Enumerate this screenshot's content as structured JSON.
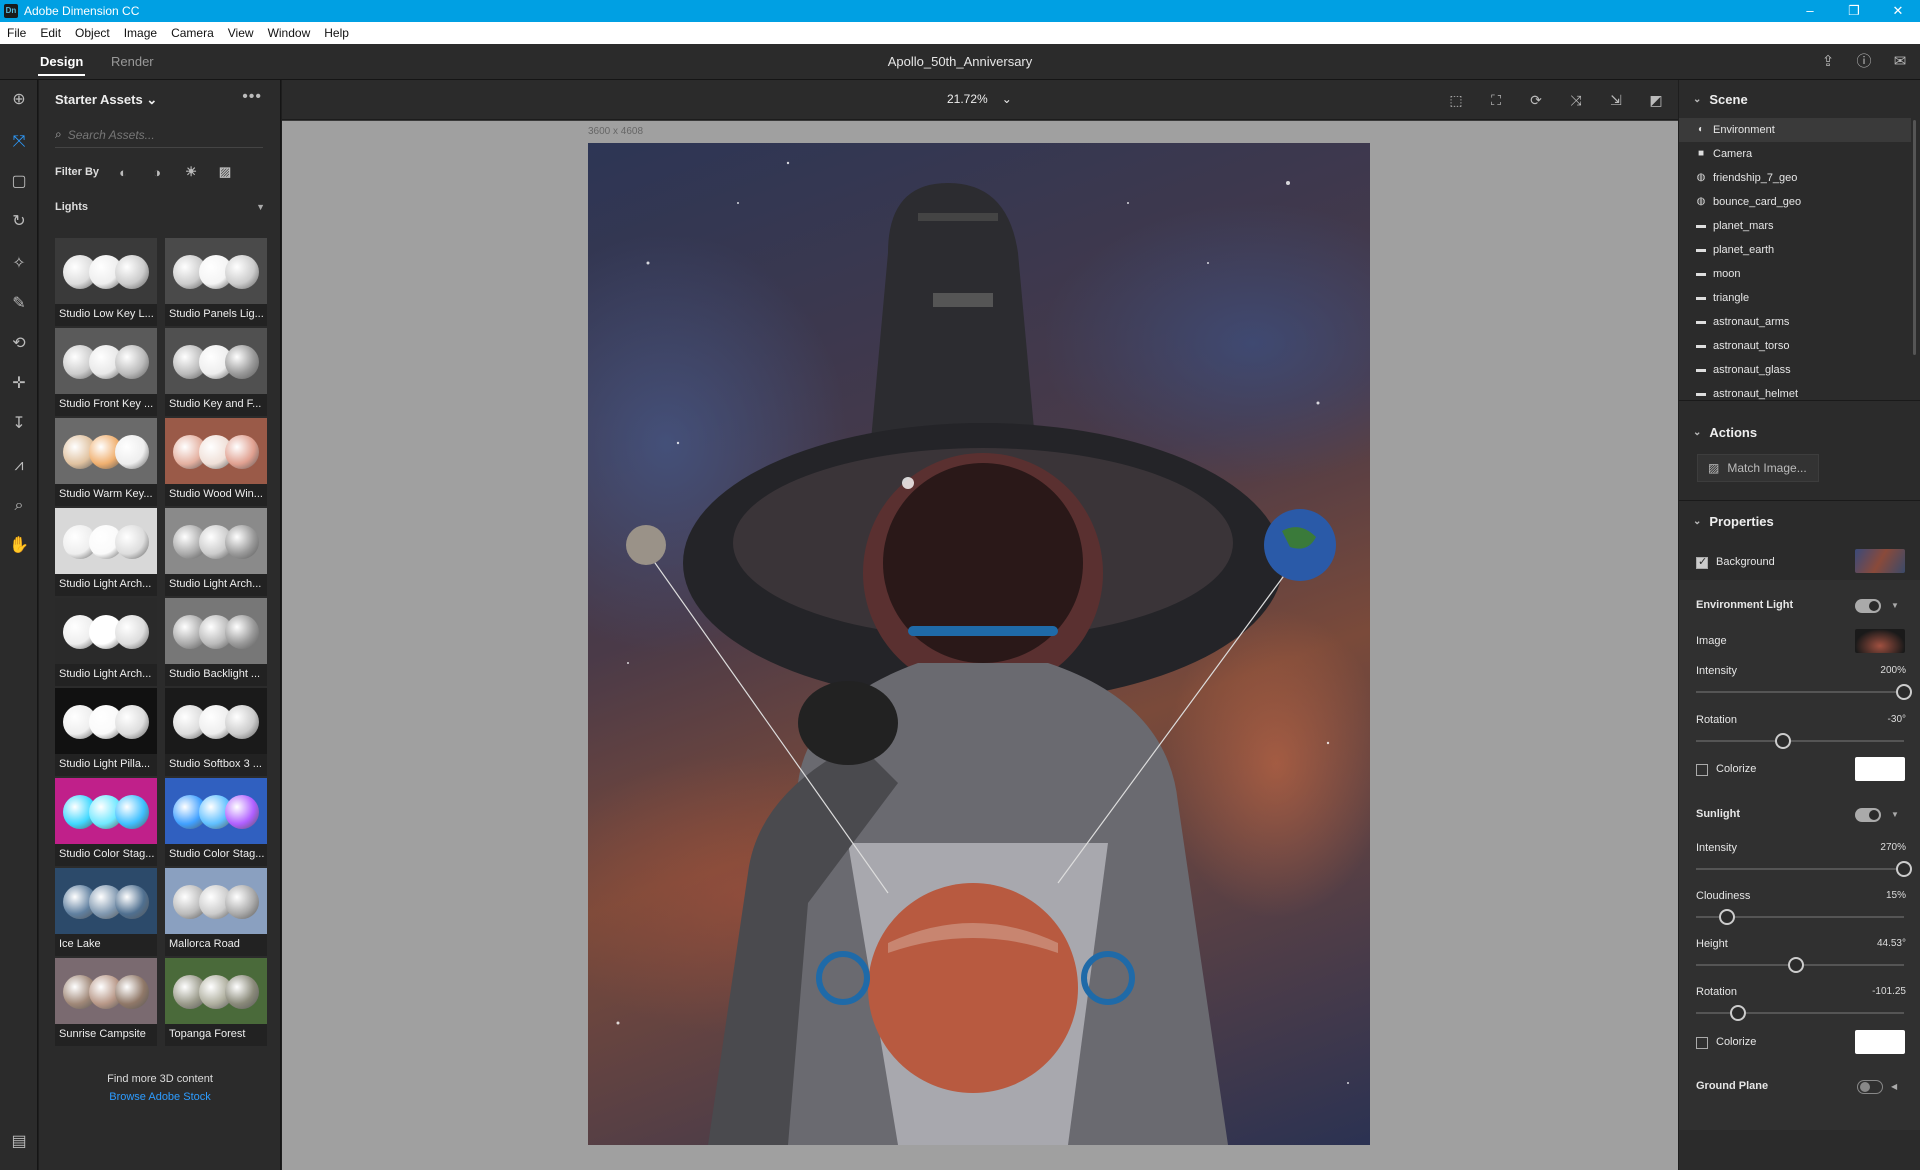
{
  "window": {
    "app_title": "Adobe Dimension CC",
    "app_icon": "Dn",
    "minimize": "–",
    "restore": "❐",
    "close": "✕"
  },
  "menu": [
    "File",
    "Edit",
    "Object",
    "Image",
    "Camera",
    "View",
    "Window",
    "Help"
  ],
  "modes": {
    "design": "Design",
    "render": "Render"
  },
  "document": {
    "title": "Apollo_50th_Anniversary",
    "dimensions": "3600 x 4608",
    "zoom": "21.72%"
  },
  "assets": {
    "header": "Starter Assets",
    "search_placeholder": "Search Assets...",
    "filter_label": "Filter By",
    "category": "Lights",
    "items": [
      {
        "label": "Studio Low Key L...",
        "colors": [
          "#ddd",
          "#eee",
          "#ccc"
        ],
        "bg": "#3a3a3a"
      },
      {
        "label": "Studio Panels Lig...",
        "colors": [
          "#ccc",
          "#f4f4f4",
          "#ccc"
        ],
        "bg": "#4a4a4a"
      },
      {
        "label": "Studio Front Key ...",
        "colors": [
          "#ccc",
          "#e8e8e8",
          "#bbb"
        ],
        "bg": "#5a5a5a"
      },
      {
        "label": "Studio Key and F...",
        "colors": [
          "#bbb",
          "#eee",
          "#999"
        ],
        "bg": "#505050"
      },
      {
        "label": "Studio Warm Key...",
        "colors": [
          "#e0c2a0",
          "#f0b070",
          "#eee"
        ],
        "bg": "#6a6a6a"
      },
      {
        "label": "Studio Wood Win...",
        "colors": [
          "#e4b0a0",
          "#f0e0d8",
          "#e0a090"
        ],
        "bg": "#9a5a48"
      },
      {
        "label": "Studio Light Arch...",
        "colors": [
          "#eee",
          "#fafafa",
          "#ddd"
        ],
        "bg": "#d8d8d8"
      },
      {
        "label": "Studio Light Arch...",
        "colors": [
          "#aaa",
          "#ccc",
          "#999"
        ],
        "bg": "#8a8a8a"
      },
      {
        "label": "Studio Light Arch...",
        "colors": [
          "#eee",
          "#fff",
          "#ddd"
        ],
        "bg": "#2a2a2a"
      },
      {
        "label": "Studio Backlight ...",
        "colors": [
          "#aaa",
          "#bbb",
          "#999"
        ],
        "bg": "#777"
      },
      {
        "label": "Studio Light Pilla...",
        "colors": [
          "#eee",
          "#fafafa",
          "#ddd"
        ],
        "bg": "#111"
      },
      {
        "label": "Studio Softbox 3 ...",
        "colors": [
          "#ddd",
          "#eee",
          "#ccc"
        ],
        "bg": "#1a1a1a"
      },
      {
        "label": "Studio Color Stag...",
        "colors": [
          "#40d8ff",
          "#70e8ff",
          "#40c0ff"
        ],
        "bg": "#c0208a"
      },
      {
        "label": "Studio Color Stag...",
        "colors": [
          "#40a0ff",
          "#60c0ff",
          "#b060ff"
        ],
        "bg": "#3060c0"
      },
      {
        "label": "Ice Lake",
        "colors": [
          "#6080a0",
          "#8098b0",
          "#507090"
        ],
        "bg": "#2c4a6a"
      },
      {
        "label": "Mallorca Road",
        "colors": [
          "#bbb",
          "#ccc",
          "#aaa"
        ],
        "bg": "#8aa0c0"
      },
      {
        "label": "Sunrise Campsite",
        "colors": [
          "#a08878",
          "#b89888",
          "#907868"
        ],
        "bg": "#7a6a70"
      },
      {
        "label": "Topanga Forest",
        "colors": [
          "#9a9a8a",
          "#b0b0a0",
          "#8a8a7a"
        ],
        "bg": "#4a6a3a"
      }
    ],
    "find_more": "Find more 3D content",
    "browse_link": "Browse Adobe Stock"
  },
  "scene": {
    "header": "Scene",
    "nodes": [
      {
        "label": "Environment",
        "icon": "◐",
        "selected": true
      },
      {
        "label": "Camera",
        "icon": "■",
        "selected": false
      },
      {
        "label": "friendship_7_geo",
        "icon": "◍",
        "selected": false
      },
      {
        "label": "bounce_card_geo",
        "icon": "◍",
        "selected": false
      },
      {
        "label": "planet_mars",
        "icon": "▬",
        "selected": false
      },
      {
        "label": "planet_earth",
        "icon": "▬",
        "selected": false
      },
      {
        "label": "moon",
        "icon": "▬",
        "selected": false
      },
      {
        "label": "triangle",
        "icon": "▬",
        "selected": false
      },
      {
        "label": "astronaut_arms",
        "icon": "▬",
        "selected": false
      },
      {
        "label": "astronaut_torso",
        "icon": "▬",
        "selected": false
      },
      {
        "label": "astronaut_glass",
        "icon": "▬",
        "selected": false
      },
      {
        "label": "astronaut_helmet",
        "icon": "▬",
        "selected": false
      }
    ]
  },
  "actions": {
    "header": "Actions",
    "match_image": "Match Image..."
  },
  "properties": {
    "header": "Properties",
    "background": {
      "label": "Background",
      "checked": true
    },
    "env_light": {
      "label": "Environment Light",
      "image_label": "Image",
      "intensity_label": "Intensity",
      "intensity_value": "200%",
      "intensity_pos": 1.0,
      "rotation_label": "Rotation",
      "rotation_value": "-30°",
      "rotation_pos": 0.42,
      "colorize_label": "Colorize",
      "colorize_color": "#ffffff"
    },
    "sunlight": {
      "label": "Sunlight",
      "intensity_label": "Intensity",
      "intensity_value": "270%",
      "intensity_pos": 1.0,
      "cloudiness_label": "Cloudiness",
      "cloudiness_value": "15%",
      "cloudiness_pos": 0.15,
      "height_label": "Height",
      "height_value": "44.53°",
      "height_pos": 0.48,
      "rotation_label": "Rotation",
      "rotation_value": "-101.25",
      "rotation_pos": 0.2,
      "colorize_label": "Colorize",
      "colorize_color": "#ffffff"
    },
    "ground_plane": {
      "label": "Ground Plane"
    }
  },
  "colors": {
    "accent": "#2d9cff",
    "titlebar": "#00a0e3"
  }
}
